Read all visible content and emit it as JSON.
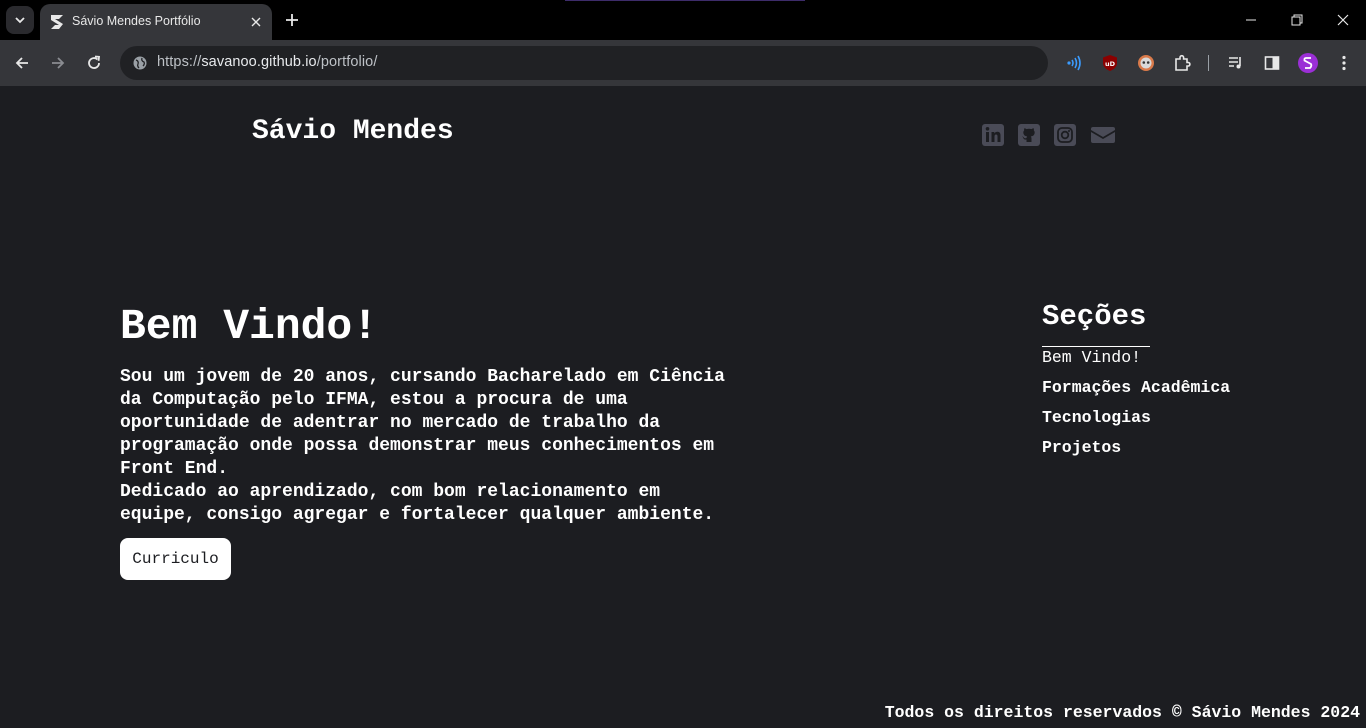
{
  "browser": {
    "tab_title": "Sávio Mendes Portfólio",
    "url_scheme": "https://",
    "url_host": "savanoo.github.io",
    "url_path": "/portfolio/"
  },
  "icons": {
    "tab_search": "chevron-down-icon",
    "tab_favicon": "portfolio-logo-icon",
    "tab_close": "close-icon",
    "new_tab": "plus-icon",
    "minimize": "minimize-icon",
    "restore": "restore-icon",
    "close_window": "close-icon",
    "back": "arrow-left-icon",
    "forward": "arrow-right-icon",
    "reload": "reload-icon",
    "site_info": "globe-icon",
    "extensions": [
      "wifi-signal-icon",
      "ublock-icon",
      "avatar-extension-icon",
      "puzzle-icon",
      "media-queue-icon",
      "side-panel-icon",
      "profile-avatar-icon",
      "kebab-menu-icon"
    ],
    "social": [
      "linkedin-icon",
      "github-icon",
      "instagram-icon",
      "email-icon"
    ]
  },
  "colors": {
    "page_background": "#1c1d21",
    "social_icon": "#4a4b57",
    "text": "#ffffff",
    "profile_avatar": "#9b2fd6"
  },
  "header": {
    "site_name": "Sávio Mendes"
  },
  "hero": {
    "title": "Bem Vindo!",
    "paragraph1": "Sou um jovem de 20 anos, cursando Bacharelado em Ciência\nda Computação pelo IFMA, estou a procura de uma\noportunidade de adentrar no mercado de trabalho da\nprogramação onde possa demonstrar meus conhecimentos em\nFront End.",
    "paragraph2": "Dedicado ao aprendizado, com bom relacionamento em\nequipe, consigo agregar e fortalecer qualquer ambiente.",
    "button_label": "Curriculo"
  },
  "sections": {
    "title": "Seções",
    "items": [
      "Bem Vindo!",
      "Formações Acadêmica",
      "Tecnologias",
      "Projetos"
    ]
  },
  "footer": {
    "text": "Todos os direitos reservados © Sávio Mendes 2024"
  }
}
